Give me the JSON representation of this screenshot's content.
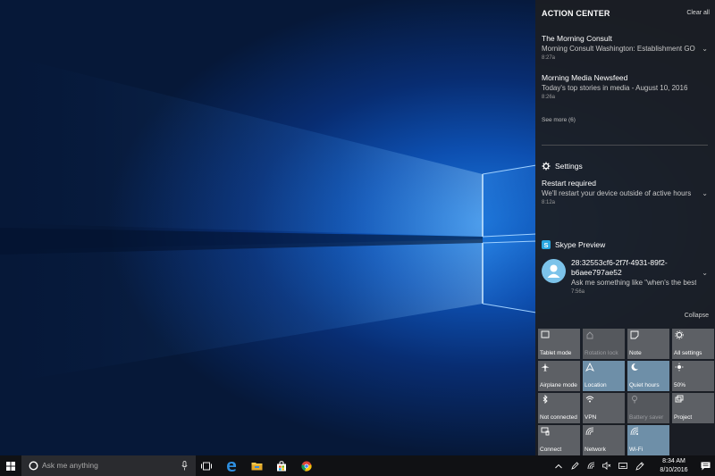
{
  "action_center": {
    "title": "ACTION CENTER",
    "clear_all": "Clear all",
    "notifications": [
      {
        "title": "The Morning Consult",
        "body": "Morning Consult Washington: Establishment GOP",
        "time": "8:27a"
      },
      {
        "title": "Morning Media Newsfeed",
        "body": "Today's top stories in media - August 10, 2016",
        "time": "8:26a"
      }
    ],
    "see_more": "See more (6)",
    "settings": {
      "app": "Settings",
      "icon": "gear-icon",
      "title": "Restart required",
      "body": "We'll restart your device outside of active hours",
      "time": "8:12a"
    },
    "skype": {
      "app": "Skype Preview",
      "icon": "skype-icon",
      "title_line1": "28:32553cf6-2f7f-4931-89f2-",
      "title_line2": "b6aee797ae52",
      "body": "Ask me something like \"when's the best",
      "time": "7:56a",
      "avatar_color": "#7cc3ea"
    },
    "collapse": "Collapse"
  },
  "quick_actions": [
    {
      "label": "Tablet mode",
      "icon": "tablet-mode-icon",
      "state": "off"
    },
    {
      "label": "Rotation lock",
      "icon": "rotation-lock-icon",
      "state": "disabled"
    },
    {
      "label": "Note",
      "icon": "note-icon",
      "state": "off"
    },
    {
      "label": "All settings",
      "icon": "gear-icon",
      "state": "off"
    },
    {
      "label": "Airplane mode",
      "icon": "airplane-icon",
      "state": "off"
    },
    {
      "label": "Location",
      "icon": "location-icon",
      "state": "on"
    },
    {
      "label": "Quiet hours",
      "icon": "moon-icon",
      "state": "on"
    },
    {
      "label": "50%",
      "icon": "brightness-icon",
      "state": "off"
    },
    {
      "label": "Not connected",
      "icon": "bluetooth-icon",
      "state": "off"
    },
    {
      "label": "VPN",
      "icon": "vpn-icon",
      "state": "off"
    },
    {
      "label": "Battery saver",
      "icon": "battery-saver-icon",
      "state": "disabled"
    },
    {
      "label": "Project",
      "icon": "project-icon",
      "state": "off"
    },
    {
      "label": "Connect",
      "icon": "connect-icon",
      "state": "off"
    },
    {
      "label": "Network",
      "icon": "network-icon",
      "state": "off"
    },
    {
      "label": "Wi-Fi",
      "icon": "wifi-icon",
      "state": "on"
    }
  ],
  "taskbar": {
    "search_placeholder": "Ask me anything",
    "apps": [
      "task-view-icon",
      "edge-icon",
      "file-explorer-icon",
      "store-icon",
      "chrome-icon"
    ],
    "clock_time": "8:34 AM",
    "clock_date": "8/10/2016"
  },
  "colors": {
    "action_center_bg": "#1c1e22",
    "tile_default": "#5d6065",
    "tile_active": "#6e8fa8",
    "wallpaper_blue": "#1c7be0",
    "taskbar_bg": "#101114"
  }
}
